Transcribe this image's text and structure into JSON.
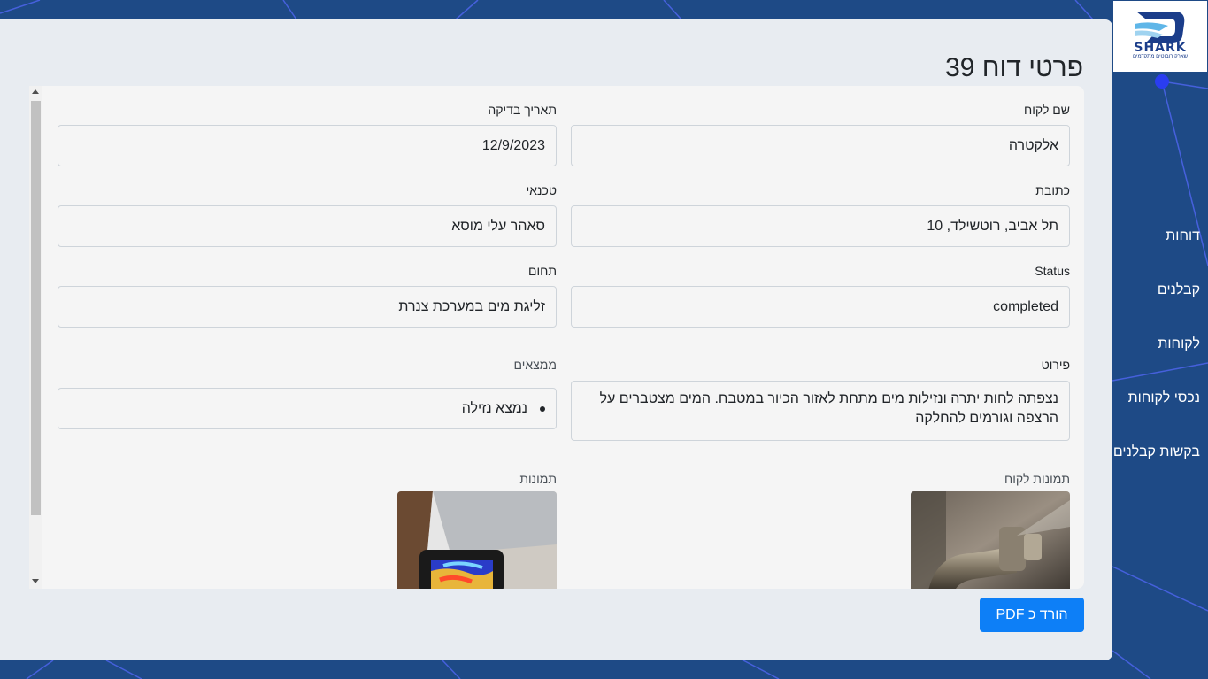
{
  "brand": {
    "name": "SHARK",
    "tagline": "שארק רובוטים מתקדמים"
  },
  "nav": {
    "items": [
      {
        "label": "דוחות"
      },
      {
        "label": "קבלנים"
      },
      {
        "label": "לקוחות"
      },
      {
        "label": "נכסי לקוחות"
      },
      {
        "label": "בקשות קבלנים"
      }
    ]
  },
  "page": {
    "title": "פרטי דוח 39"
  },
  "report": {
    "customer_name": {
      "label": "שם לקוח",
      "value": "אלקטרה"
    },
    "inspection_date": {
      "label": "תאריך בדיקה",
      "value": "12/9/2023"
    },
    "address": {
      "label": "כתובת",
      "value": "תל אביב, רוטשילד, 10"
    },
    "technician": {
      "label": "טכנאי",
      "value": "סאהר עלי מוסא"
    },
    "status": {
      "label": "Status",
      "value": "completed"
    },
    "field": {
      "label": "תחום",
      "value": "זליגת מים במערכת צנרת"
    },
    "details": {
      "label": "פירוט",
      "value": "נצפתה לחות יתרה ונזילות מים מתחת לאזור הכיור במטבח. המים מצטברים על הרצפה וגורמים להחלקה"
    },
    "findings": {
      "label": "ממצאים",
      "items": [
        "נמצא נזילה"
      ]
    },
    "customer_photos": {
      "label": "תמונות לקוח"
    },
    "photos": {
      "label": "תמונות"
    }
  },
  "actions": {
    "download_pdf": "הורד כ PDF"
  },
  "colors": {
    "background": "#1e4a86",
    "accent": "#0d7ff7",
    "panel": "#e8ecf1"
  }
}
